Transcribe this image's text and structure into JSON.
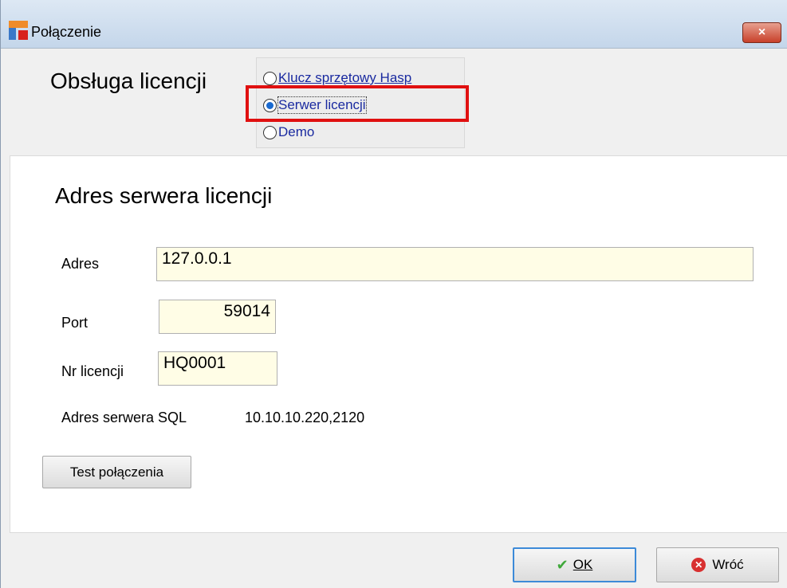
{
  "window": {
    "title": "Połączenie",
    "close_label": "×"
  },
  "header": {
    "label": "Obsługa licencji"
  },
  "license_mode": {
    "options": [
      {
        "label": "Klucz sprzętowy Hasp",
        "checked": false
      },
      {
        "label": "Serwer licencji",
        "checked": true
      },
      {
        "label": "Demo",
        "checked": false
      }
    ]
  },
  "server_panel": {
    "title": "Adres serwera licencji",
    "address_label": "Adres",
    "address_value": "127.0.0.1",
    "port_label": "Port",
    "port_value": "59014",
    "license_label": "Nr  licencji",
    "license_value": "HQ0001",
    "sql_label": "Adres serwera SQL",
    "sql_value": "10.10.10.220,2120",
    "test_button": "Test połączenia"
  },
  "footer": {
    "ok_label": "OK",
    "back_label": "Wróć"
  },
  "colors": {
    "input_background": "#fffde6",
    "highlight": "#e01010",
    "radio_text": "#1a2aa0"
  }
}
